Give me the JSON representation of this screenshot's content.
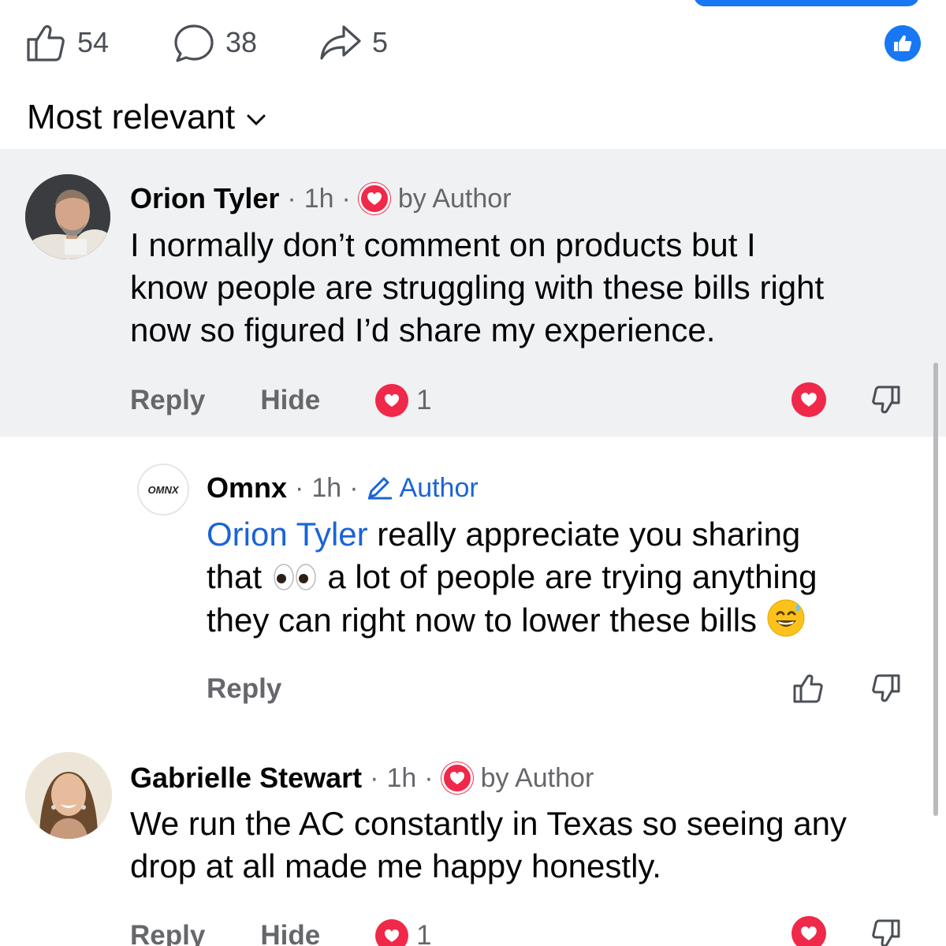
{
  "stats": {
    "likes": "54",
    "comments": "38",
    "shares": "5"
  },
  "sort": {
    "label": "Most relevant"
  },
  "comments": [
    {
      "author": "Orion Tyler",
      "time": "1h",
      "badge": "by Author",
      "text_lines": [
        "I normally don’t comment on products but I",
        "know people are struggling with these bills right",
        "now so figured I’d share my experience."
      ],
      "reply_label": "Reply",
      "hide_label": "Hide",
      "reaction_count": "1"
    },
    {
      "author": "Omnx",
      "avatar_text": "OMNX",
      "time": "1h",
      "badge": "Author",
      "mention": "Orion Tyler",
      "text_line1": " really appreciate you sharing",
      "text_line2a": "that ",
      "text_line2b": " a lot of people are trying anything",
      "text_line3": "they can right now to lower these bills ",
      "reply_label": "Reply"
    },
    {
      "author": "Gabrielle Stewart",
      "time": "1h",
      "badge": "by Author",
      "text_lines": [
        "We run the AC constantly in Texas so seeing any",
        "drop at all made me happy honestly."
      ],
      "reply_label": "Reply",
      "hide_label": "Hide",
      "reaction_count": "1"
    }
  ],
  "colors": {
    "accent": "#1877f2",
    "heart": "#f02849",
    "link": "#1a64d6",
    "highlight_bg": "#f0f1f3"
  },
  "icons": [
    "thumbs-up-icon",
    "comment-icon",
    "share-icon",
    "like-badge-icon",
    "chevron-down-icon",
    "heart-icon",
    "thumbs-down-icon",
    "pencil-icon",
    "eyes-emoji",
    "sweat-smile-emoji"
  ]
}
